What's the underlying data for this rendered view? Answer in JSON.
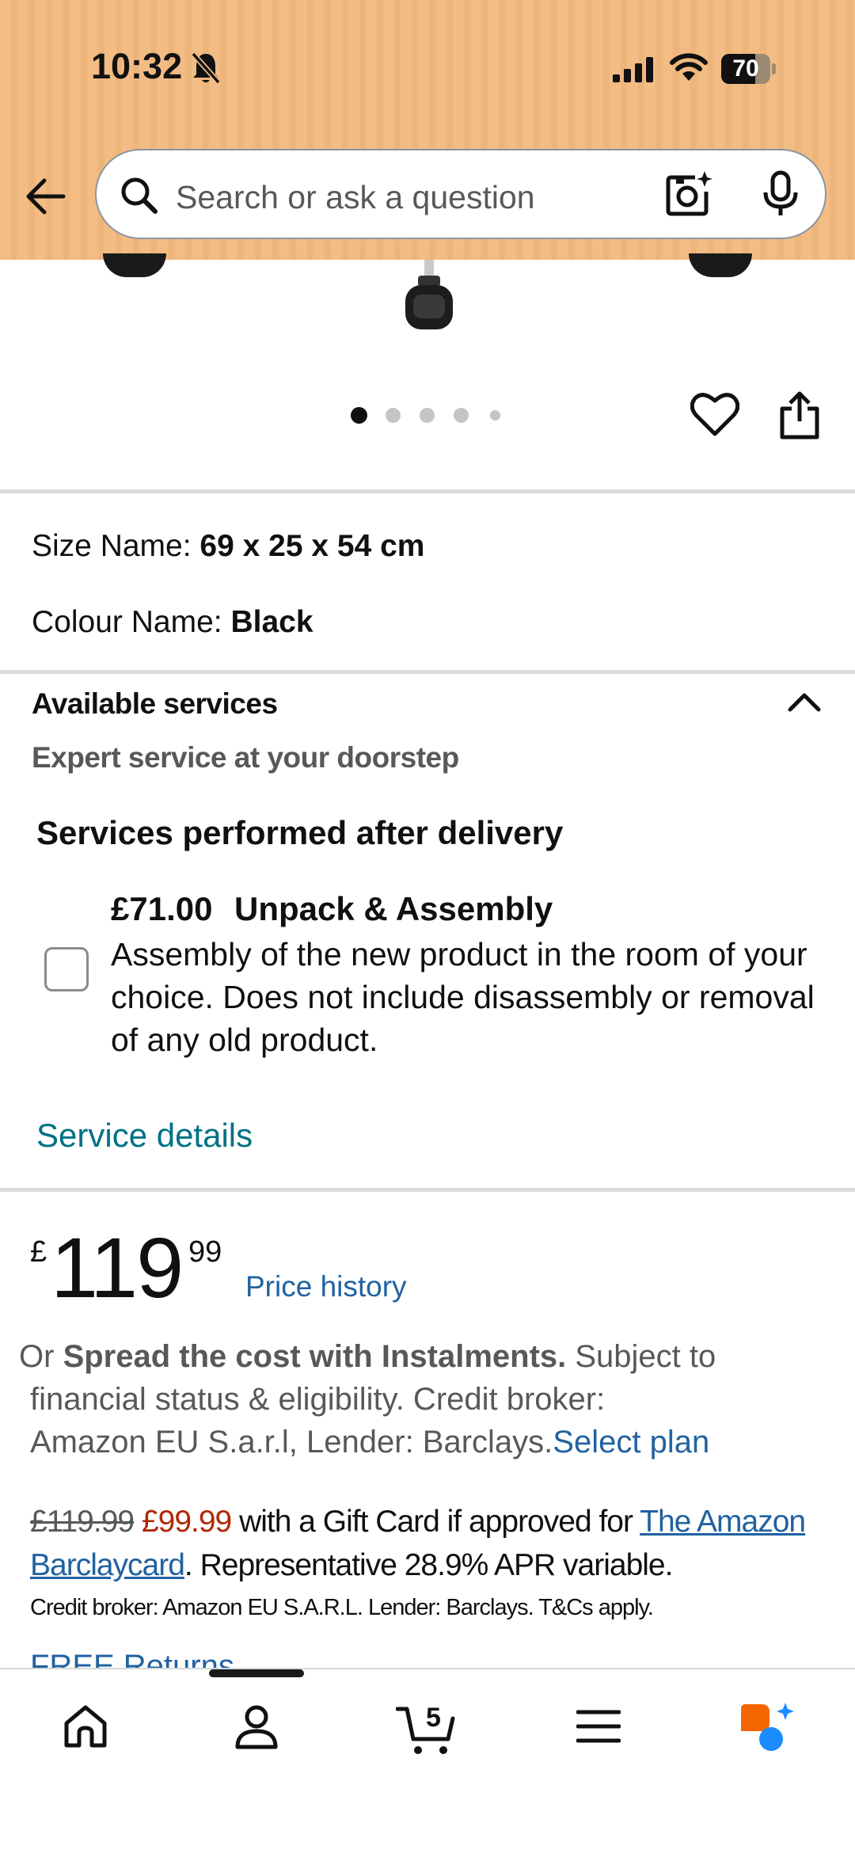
{
  "status_bar": {
    "time": "10:32",
    "battery": "70",
    "battery_level": 0.7
  },
  "search": {
    "placeholder": "Search or ask a question"
  },
  "gallery": {
    "dot_count": 5,
    "active_dot": 1
  },
  "product": {
    "size_label": "Size Name:",
    "size_value": "69 x 25 x 54 cm",
    "colour_label": "Colour Name:",
    "colour_value": "Black"
  },
  "services": {
    "title": "Available services",
    "subtitle": "Expert service at your doorstep",
    "section_heading": "Services performed after delivery",
    "option_price": "£71.00",
    "option_name": "Unpack & Assembly",
    "option_desc": "Assembly of the new product in the room of your choice. Does not include disassembly or removal of any old product.",
    "option_checked": false,
    "details_link": "Service details"
  },
  "price": {
    "currency": "£",
    "whole": "119",
    "fraction": "99",
    "history_link": "Price history"
  },
  "instalments": {
    "prefix": "Or",
    "bold": "Spread the cost with Instalments.",
    "line1_rest": "Subject to",
    "line2": "financial status & eligibility. Credit broker:",
    "line3": "Amazon EU S.a.r.l, Lender: Barclays.",
    "select_plan": "Select plan"
  },
  "gift_card": {
    "old_price": "£119.99",
    "new_price": "£99.99",
    "text1": "with a Gift Card if approved for",
    "link": "The Amazon Barclaycard",
    "text2": ". Representative 28.9% APR variable.",
    "fine_print": "Credit broker: Amazon EU S.A.R.L. Lender: Barclays. T&Cs apply."
  },
  "returns": {
    "label": "FREE Returns"
  },
  "bottom_nav": {
    "cart_count": "5",
    "items": [
      "home-icon",
      "account-icon",
      "cart-icon",
      "menu-icon",
      "rufus-icon"
    ]
  },
  "colors": {
    "header_bg": "#f2bc84",
    "link": "#2162a1",
    "teal_link": "#007185",
    "deal_red": "#b12704",
    "rufus_orange": "#f56600",
    "rufus_blue": "#1a8cff"
  }
}
